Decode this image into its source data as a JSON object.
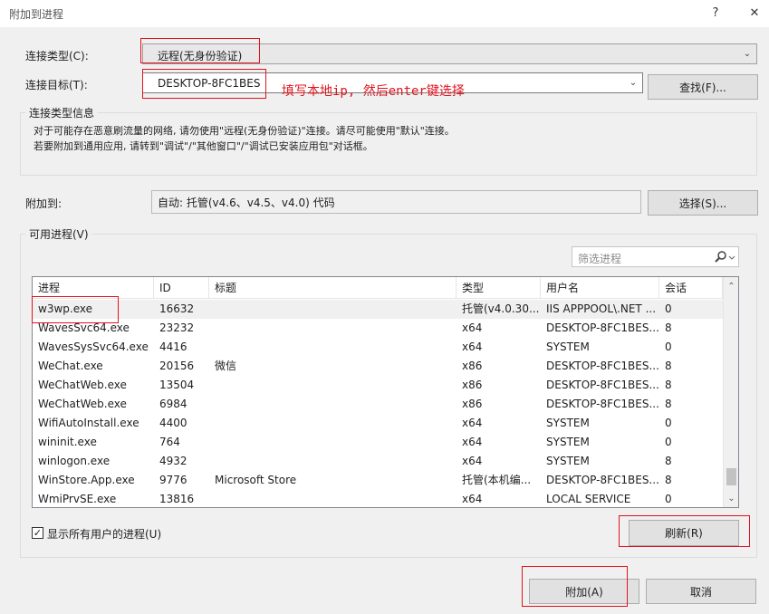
{
  "window": {
    "title": "附加到进程",
    "help_label": "?",
    "close_label": "✕"
  },
  "connection_type": {
    "label": "连接类型(C):",
    "value": "远程(无身份验证)"
  },
  "connection_target": {
    "label": "连接目标(T):",
    "value": "DESKTOP-8FC1BES",
    "find_button": "查找(F)..."
  },
  "annotation": "填写本地ip, 然后enter键选择",
  "info": {
    "title": "连接类型信息",
    "line1": "对于可能存在恶意刷流量的网络, 请勿使用\"远程(无身份验证)\"连接。请尽可能使用\"默认\"连接。",
    "line2": "若要附加到通用应用, 请转到\"调试\"/\"其他窗口\"/\"调试已安装应用包\"对话框。"
  },
  "attach_to": {
    "label": "附加到:",
    "value": "自动: 托管(v4.6、v4.5、v4.0) 代码",
    "select_button": "选择(S)..."
  },
  "processes": {
    "title": "可用进程(V)",
    "filter_placeholder": "筛选进程",
    "columns": [
      "进程",
      "ID",
      "标题",
      "类型",
      "用户名",
      "会话"
    ],
    "rows": [
      [
        "w3wp.exe",
        "16632",
        "",
        "托管(v4.0.30...",
        "IIS APPPOOL\\.NET ...",
        "0"
      ],
      [
        "WavesSvc64.exe",
        "23232",
        "",
        "x64",
        "DESKTOP-8FC1BES...",
        "8"
      ],
      [
        "WavesSysSvc64.exe",
        "4416",
        "",
        "x64",
        "SYSTEM",
        "0"
      ],
      [
        "WeChat.exe",
        "20156",
        "微信",
        "x86",
        "DESKTOP-8FC1BES...",
        "8"
      ],
      [
        "WeChatWeb.exe",
        "13504",
        "",
        "x86",
        "DESKTOP-8FC1BES...",
        "8"
      ],
      [
        "WeChatWeb.exe",
        "6984",
        "",
        "x86",
        "DESKTOP-8FC1BES...",
        "8"
      ],
      [
        "WifiAutoInstall.exe",
        "4400",
        "",
        "x64",
        "SYSTEM",
        "0"
      ],
      [
        "wininit.exe",
        "764",
        "",
        "x64",
        "SYSTEM",
        "0"
      ],
      [
        "winlogon.exe",
        "4932",
        "",
        "x64",
        "SYSTEM",
        "8"
      ],
      [
        "WinStore.App.exe",
        "9776",
        "Microsoft Store",
        "托管(本机编...",
        "DESKTOP-8FC1BES...",
        "8"
      ],
      [
        "WmiPrvSE.exe",
        "13816",
        "",
        "x64",
        "LOCAL SERVICE",
        "0"
      ]
    ],
    "show_all_users": {
      "label": "显示所有用户的进程(U)",
      "checked": true
    },
    "refresh_button": "刷新(R)"
  },
  "footer": {
    "attach_button": "附加(A)",
    "cancel_button": "取消"
  },
  "colors": {
    "annotation_red": "#e0141e",
    "background": "#f0f0f0"
  }
}
